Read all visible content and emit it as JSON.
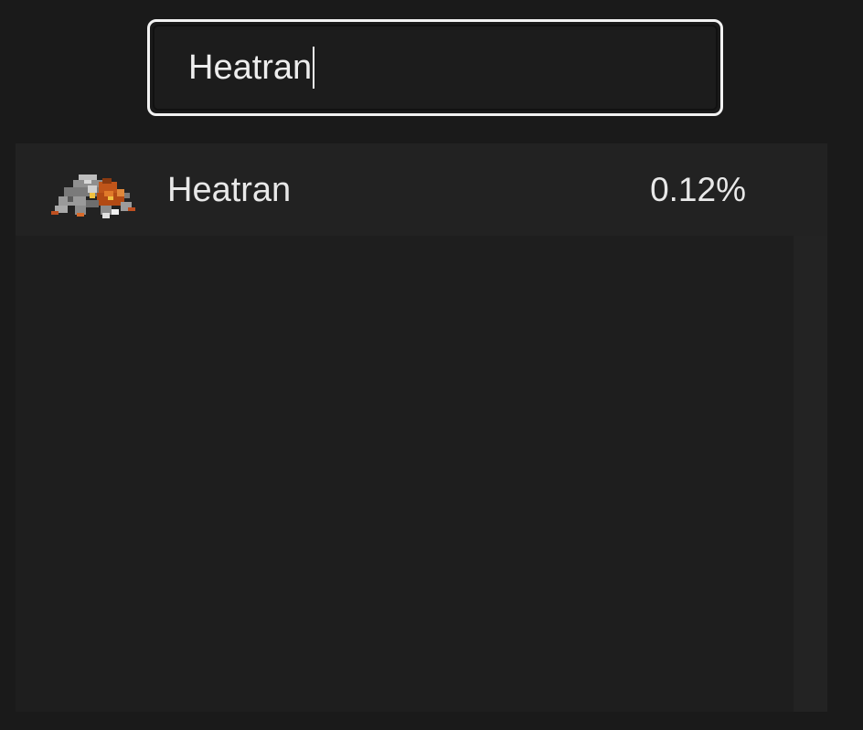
{
  "search": {
    "value": "Heatran"
  },
  "results": [
    {
      "name": "Heatran",
      "usage": "0.12%",
      "icon": "heatran-sprite-icon"
    }
  ],
  "colors": {
    "background": "#1a1a1a",
    "panel": "#222222",
    "list": "#1e1e1e",
    "search_border": "#f2f2f2",
    "text": "#e8e8e8"
  }
}
